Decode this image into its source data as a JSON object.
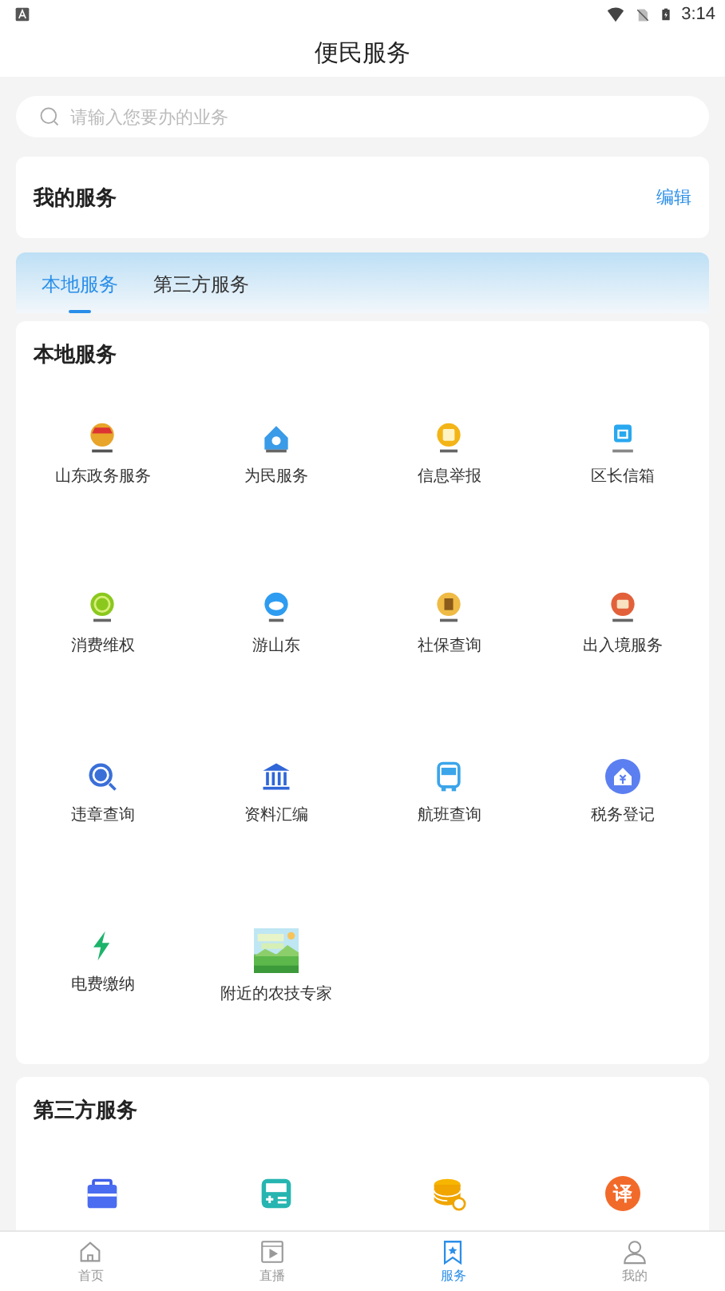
{
  "status_bar": {
    "time": "3:14"
  },
  "header": {
    "title": "便民服务"
  },
  "search": {
    "placeholder": "请输入您要办的业务"
  },
  "my_services": {
    "title": "我的服务",
    "action": "编辑"
  },
  "tabs": [
    {
      "label": "本地服务",
      "selected": true
    },
    {
      "label": "第三方服务",
      "selected": false
    }
  ],
  "sections": [
    {
      "title": "本地服务",
      "items": [
        {
          "label": "山东政务服务",
          "kind": "icon"
        },
        {
          "label": "为民服务",
          "kind": "icon"
        },
        {
          "label": "信息举报",
          "kind": "icon"
        },
        {
          "label": "区长信箱",
          "kind": "icon"
        },
        {
          "label": "消费维权",
          "kind": "icon"
        },
        {
          "label": "游山东",
          "kind": "icon"
        },
        {
          "label": "社保查询",
          "kind": "icon"
        },
        {
          "label": "出入境服务",
          "kind": "icon"
        },
        {
          "label": "违章查询",
          "kind": "icon"
        },
        {
          "label": "资料汇编",
          "kind": "icon"
        },
        {
          "label": "航班查询",
          "kind": "icon"
        },
        {
          "label": "税务登记",
          "kind": "icon"
        },
        {
          "label": "电费缴纳",
          "kind": "icon"
        },
        {
          "label": "附近的农技专家",
          "kind": "picture"
        }
      ]
    },
    {
      "title": "第三方服务",
      "items": [
        {
          "kind": "icon"
        },
        {
          "kind": "icon"
        },
        {
          "kind": "icon"
        },
        {
          "kind": "glyph",
          "glyph": "译"
        }
      ]
    }
  ],
  "nav": [
    {
      "label": "首页",
      "selected": false
    },
    {
      "label": "直播",
      "selected": false
    },
    {
      "label": "服务",
      "selected": true
    },
    {
      "label": "我的",
      "selected": false
    }
  ]
}
